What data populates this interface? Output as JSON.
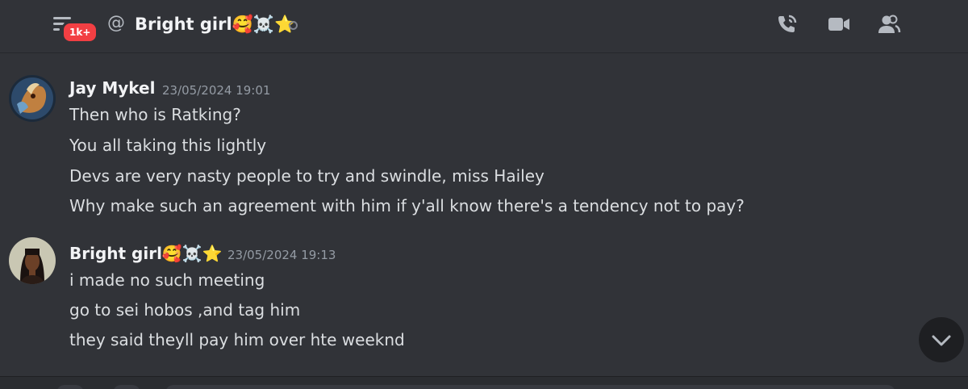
{
  "header": {
    "badge": "1k+",
    "channel_name": "Bright girl🥰☠️⭐",
    "icons": [
      "menu-icon",
      "at-icon",
      "call-icon",
      "video-icon",
      "members-icon"
    ]
  },
  "messages": [
    {
      "author": "Jay Mykel",
      "timestamp": "23/05/2024 19:01",
      "lines": [
        "Then who is Ratking?",
        "You all taking this lightly",
        "Devs are very nasty people to try and swindle, miss Hailey",
        "Why make such an agreement with him if y'all know there's a tendency not to pay?"
      ]
    },
    {
      "author": "Bright girl🥰☠️⭐",
      "timestamp": "23/05/2024 19:13",
      "lines": [
        "i made no such meeting",
        "go to sei hobos ,and tag him",
        "they said theyll pay him over hte weeknd"
      ]
    }
  ],
  "colors": {
    "background": "#313338",
    "badge": "#f23f43",
    "text": "#dbdee1",
    "muted": "#949ba4"
  }
}
